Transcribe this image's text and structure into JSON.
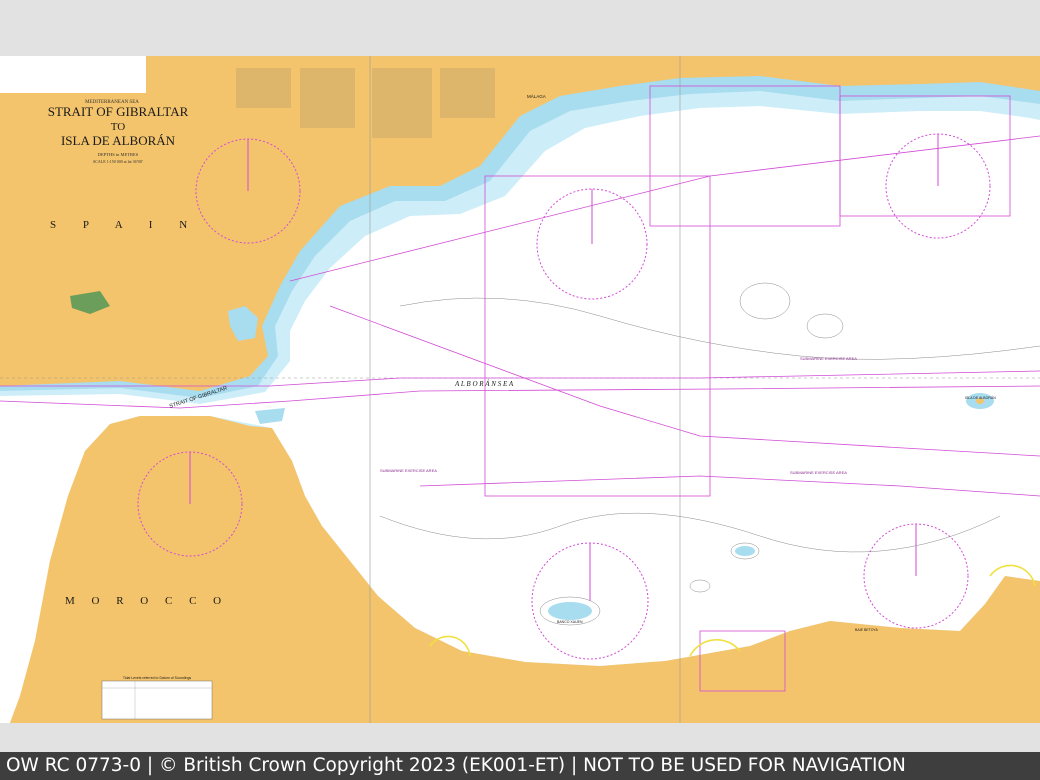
{
  "chart": {
    "header_small": "MEDITERRANEAN SEA",
    "title_line1": "STRAIT OF GIBRALTAR",
    "title_line2": "TO",
    "title_line3": "ISLA DE ALBORÁN",
    "depths_note": "DEPTHS in METRES",
    "scale_note": "SCALE 1:150 000 at lat 36°00'"
  },
  "labels": {
    "spain": "S P A I N",
    "morocco": "M O R O C C O",
    "alboran_sea": "A L B O R Á N   S E A",
    "strait": "STRAIT OF GIBRALTAR",
    "malaga": "MÁLAGA",
    "submarine_area_1": "SUBMARINE EXERCISE AREA",
    "submarine_area_2": "SUBMARINE EXERCISE AREA",
    "submarine_area_3": "SUBMARINE EXERCISE AREA",
    "isla_alboran": "ISLA DE ALBORÁN",
    "banco_xauen": "BANCO XAUEN",
    "bahia_betoya": "BAIE BETOYA",
    "tidal_table": "Tidal Levels referred to Datum of Soundings"
  },
  "colors": {
    "land": "#f3c46b",
    "shallow": "#a8dcef",
    "mid": "#cdeef8",
    "deep": "#ffffff",
    "magenta": "#d24bd6",
    "footer_bg": "#3e3e3e"
  },
  "footer": {
    "text": "OW RC 0773-0 | © British Crown Copyright 2023 (EK001-ET) | NOT TO BE USED FOR NAVIGATION"
  }
}
